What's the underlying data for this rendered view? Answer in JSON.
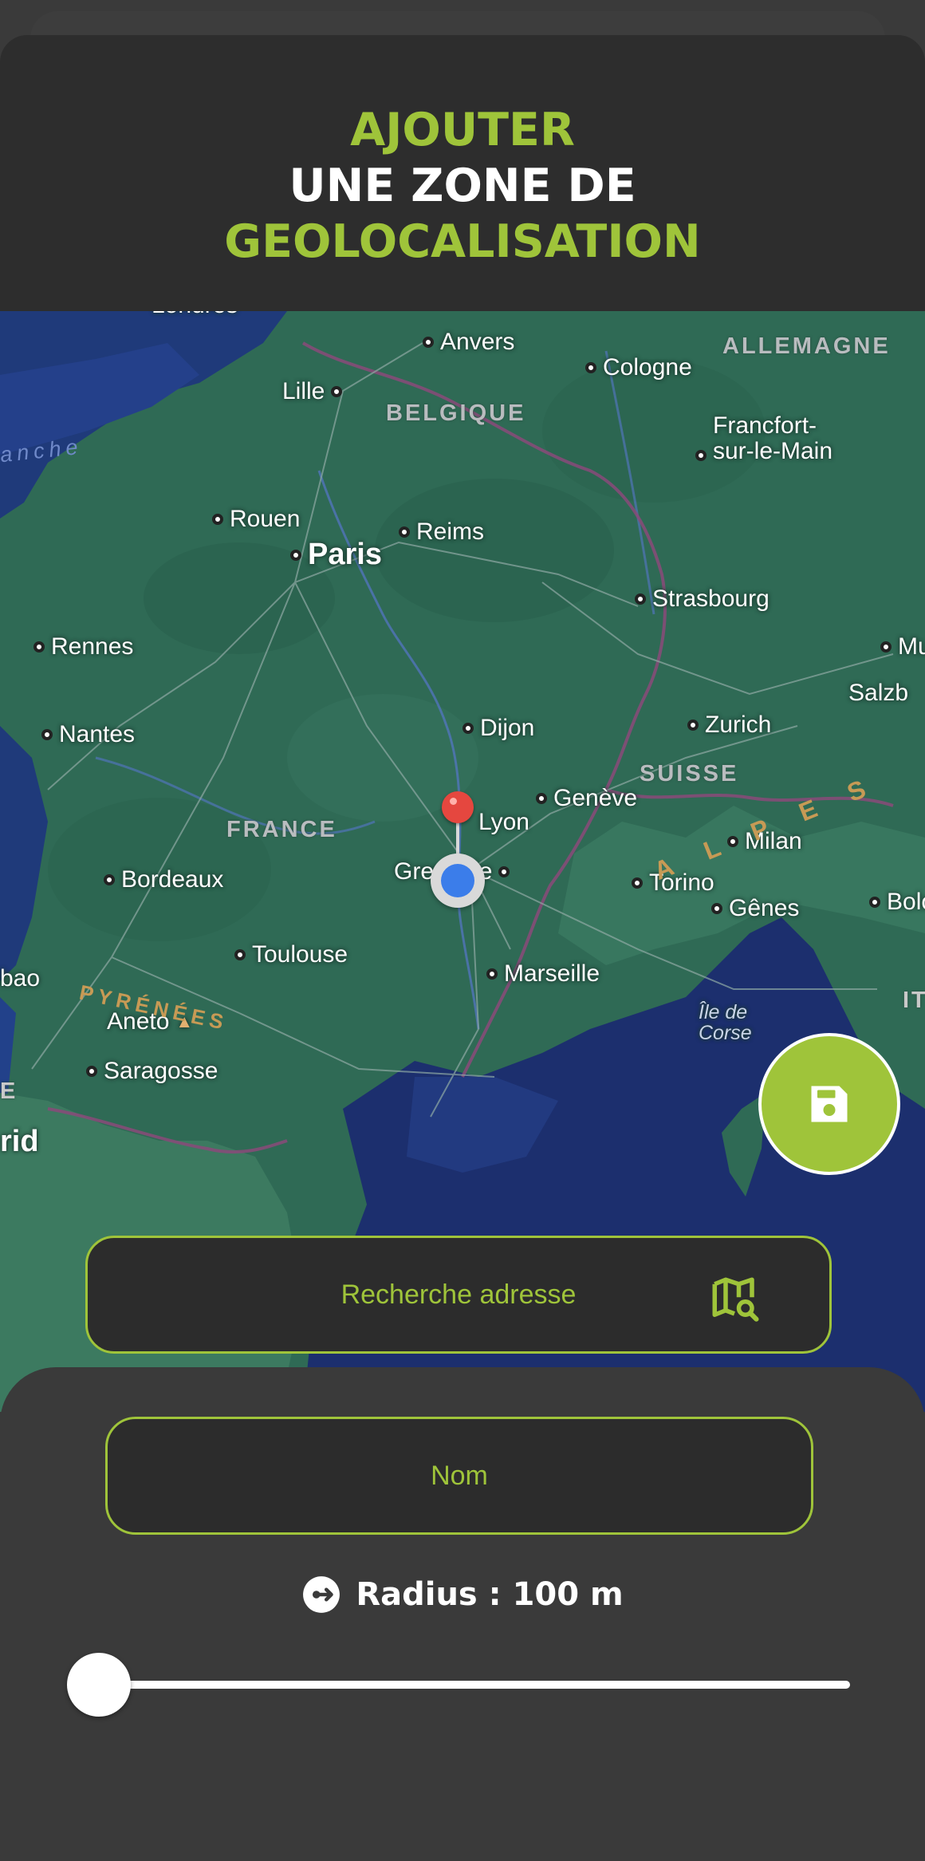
{
  "header": {
    "title_line1": "AJOUTER",
    "title_line2": "UNE ZONE DE",
    "title_line3": "GEOLOCALISATION"
  },
  "map": {
    "cities": {
      "londres": "Londres",
      "anvers": "Anvers",
      "cologne": "Cologne",
      "lille": "Lille",
      "francfort": "Francfort-\nsur-le-Main",
      "rouen": "Rouen",
      "reims": "Reims",
      "paris": "Paris",
      "strasbourg": "Strasbourg",
      "rennes": "Rennes",
      "mu": "Mu",
      "salzb": "Salzb",
      "nantes": "Nantes",
      "dijon": "Dijon",
      "zurich": "Zurich",
      "geneve": "Genève",
      "lyon": "Lyon",
      "milan": "Milan",
      "bordeaux": "Bordeaux",
      "grenoble": "Grenoble",
      "torino": "Torino",
      "genes": "Gênes",
      "bolo": "Bolo",
      "toulouse": "Toulouse",
      "marseille": "Marseille",
      "bilbao": "bao",
      "aneto": "Aneto",
      "saragosse": "Saragosse",
      "madrid": "rid",
      "corse": "Île de\nCorse"
    },
    "countries": {
      "allemagne": "ALLEMAGNE",
      "belgique": "BELGIQUE",
      "france": "FRANCE",
      "suisse": "SUISSE",
      "italie": "IT",
      "espagne": "E"
    },
    "sea": {
      "manche": "anche"
    },
    "mountains": {
      "pyrenees": "PYRÉNÉES",
      "alpes": "ALPES"
    }
  },
  "search": {
    "placeholder": "Recherche adresse",
    "icon": "map-search-icon"
  },
  "form": {
    "name_placeholder": "Nom",
    "radius_label": "Radius : 100 m",
    "radius_value_m": 100,
    "radius_slider_fraction": 0.0
  },
  "colors": {
    "accent": "#9fc43a",
    "header_bg": "#2d2d2d",
    "panel_bg": "#3a3a3a",
    "pin": "#e5473f",
    "location_dot": "#3b7dea"
  }
}
